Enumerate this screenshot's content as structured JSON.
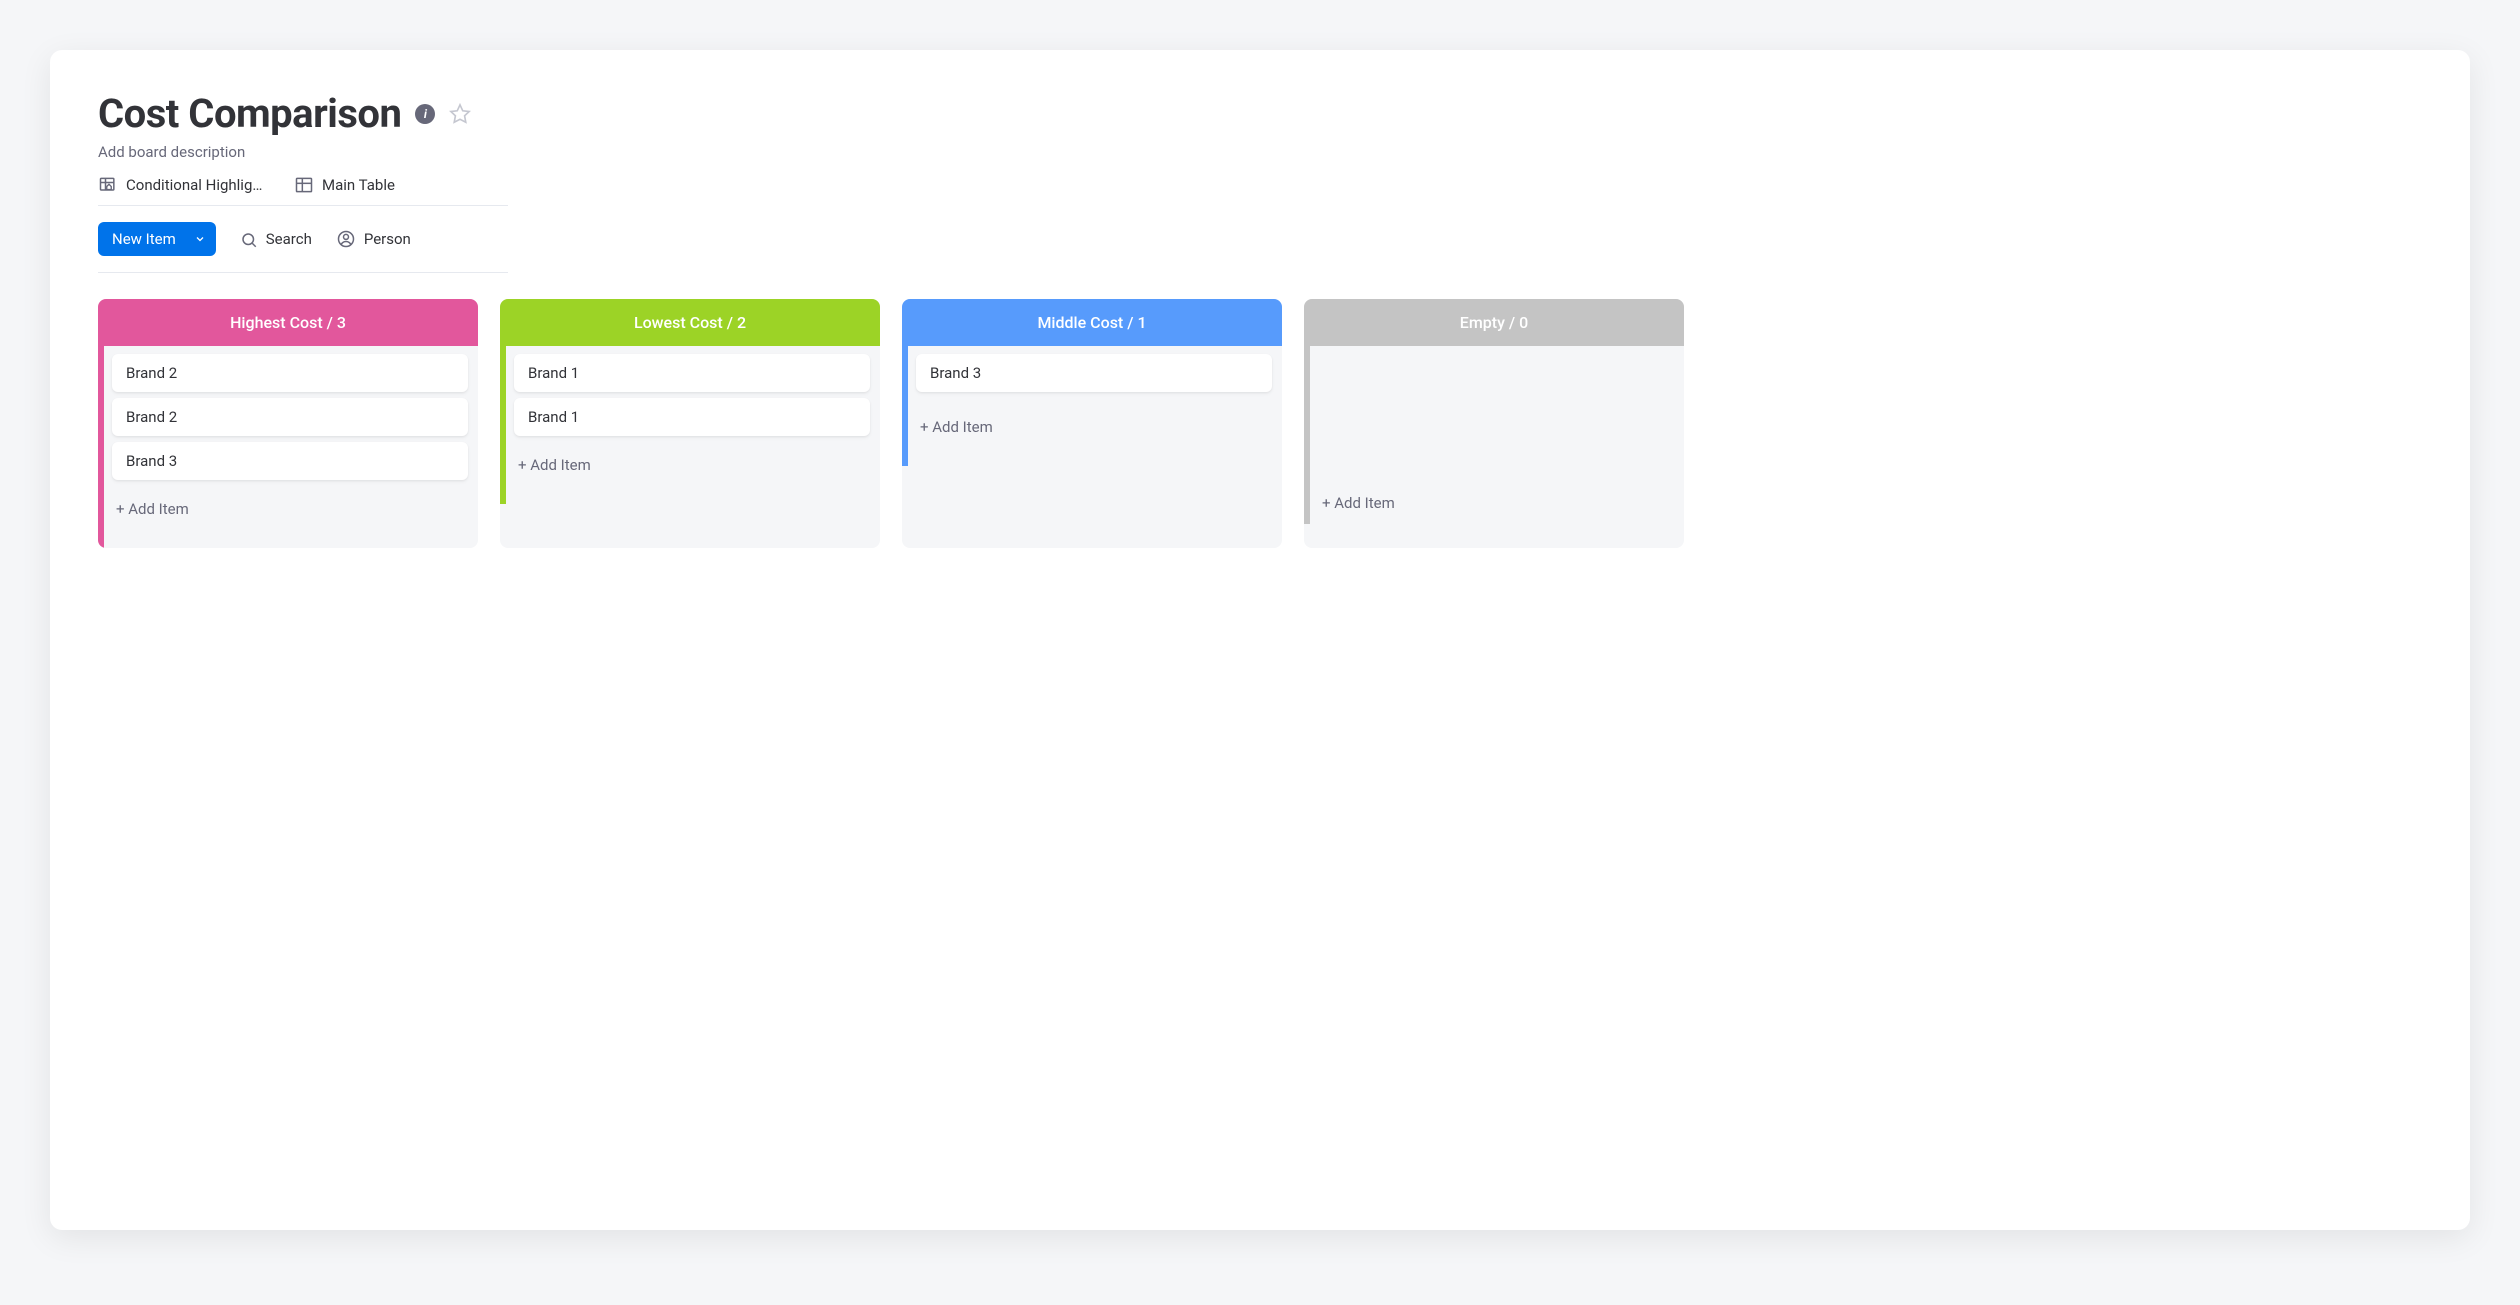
{
  "board": {
    "title": "Cost Comparison",
    "description_placeholder": "Add board description"
  },
  "views": [
    {
      "label": "Conditional Highlighting",
      "icon": "table-home"
    },
    {
      "label": "Main Table",
      "icon": "table"
    }
  ],
  "toolbar": {
    "new_item_label": "New Item",
    "search_label": "Search",
    "person_label": "Person"
  },
  "columns": [
    {
      "title": "Highest Cost / 3",
      "color": "pink",
      "items": [
        "Brand 2",
        "Brand 2",
        "Brand 3"
      ],
      "add_label": "+ Add Item"
    },
    {
      "title": "Lowest Cost / 2",
      "color": "green",
      "items": [
        "Brand 1",
        "Brand 1"
      ],
      "add_label": "+ Add Item"
    },
    {
      "title": "Middle Cost / 1",
      "color": "blue",
      "items": [
        "Brand 3"
      ],
      "add_label": "+ Add Item"
    },
    {
      "title": "Empty / 0",
      "color": "gray",
      "items": [],
      "add_label": "+ Add Item"
    }
  ]
}
